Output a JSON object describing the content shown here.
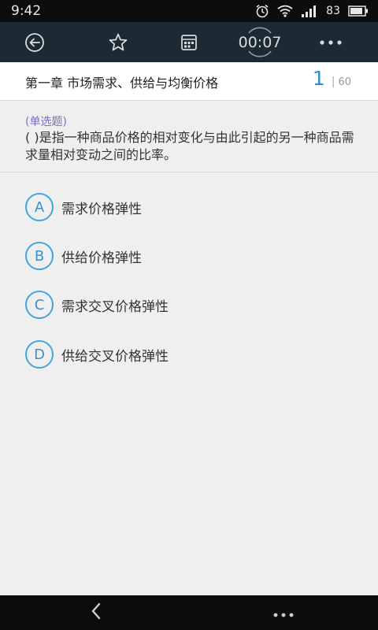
{
  "status": {
    "time": "9:42",
    "battery": "83",
    "icons": [
      "alarm-icon",
      "wifi-icon",
      "signal-icon",
      "battery-icon"
    ]
  },
  "toolbar": {
    "back_icon": "back-circle-icon",
    "favorite_icon": "star-icon",
    "answer_sheet_icon": "card-icon",
    "timer": "00:07",
    "more_icon": "more-dots-icon"
  },
  "chapter": {
    "title": "第一章  市场需求、供给与均衡价格",
    "current": "1",
    "separator": "|",
    "total": "60"
  },
  "question": {
    "type": "(单选题)",
    "text": "(  )是指一种商品价格的相对变化与由此引起的另一种商品需求量相对变动之间的比率。"
  },
  "options": [
    {
      "letter": "A",
      "label": "需求价格弹性"
    },
    {
      "letter": "B",
      "label": "供给价格弹性"
    },
    {
      "letter": "C",
      "label": "需求交叉价格弹性"
    },
    {
      "letter": "D",
      "label": "供给交叉价格弹性"
    }
  ],
  "colors": {
    "accent": "#43a5e0",
    "toolbar": "#1d2a33",
    "question_type": "#7b6fc4"
  }
}
